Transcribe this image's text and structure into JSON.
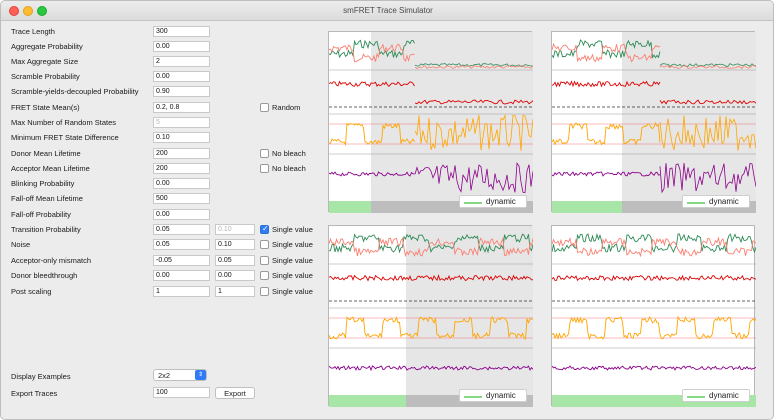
{
  "window": {
    "title": "smFRET Trace Simulator"
  },
  "params": [
    {
      "label": "Trace Length",
      "v1": "300"
    },
    {
      "label": "Aggregate Probability",
      "v1": "0.00"
    },
    {
      "label": "Max Aggregate Size",
      "v1": "2"
    },
    {
      "label": "Scramble Probability",
      "v1": "0.00"
    },
    {
      "label": "Scramble-yields-decoupled Probability",
      "v1": "0.90"
    },
    {
      "label": "FRET State Mean(s)",
      "v1": "0.2, 0.8",
      "check": {
        "label": "Random",
        "checked": false
      }
    },
    {
      "label": "Max Number of Random States",
      "v1": "5",
      "v1_disabled": true
    },
    {
      "label": "Minimum FRET State Difference",
      "v1": "0.10"
    },
    {
      "label": "Donor Mean Lifetime",
      "v1": "200",
      "check": {
        "label": "No bleach",
        "checked": false
      }
    },
    {
      "label": "Acceptor Mean Lifetime",
      "v1": "200",
      "check": {
        "label": "No bleach",
        "checked": false
      }
    },
    {
      "label": "Blinking Probability",
      "v1": "0.00"
    },
    {
      "label": "Fall-off Mean Lifetime",
      "v1": "500"
    },
    {
      "label": "Fall-off Probability",
      "v1": "0.00"
    },
    {
      "label": "Transition Probability",
      "v1": "0.05",
      "v2": "0.10",
      "v2_disabled": true,
      "check": {
        "label": "Single value",
        "checked": true
      }
    },
    {
      "label": "Noise",
      "v1": "0.05",
      "v2": "0.10",
      "check": {
        "label": "Single value",
        "checked": false
      }
    },
    {
      "label": "Acceptor-only mismatch",
      "v1": "-0.05",
      "v2": "0.05",
      "check": {
        "label": "Single value",
        "checked": false
      }
    },
    {
      "label": "Donor bleedthrough",
      "v1": "0.00",
      "v2": "0.00",
      "check": {
        "label": "Single value",
        "checked": false
      }
    },
    {
      "label": "Post scaling",
      "v1": "1",
      "v2": "1",
      "check": {
        "label": "Single value",
        "checked": false
      }
    }
  ],
  "display_examples": {
    "label": "Display Examples",
    "value": "2x2"
  },
  "export": {
    "label": "Export Traces",
    "value": "100",
    "button": "Export"
  },
  "plots": [
    {
      "legend": "dynamic"
    },
    {
      "legend": "dynamic"
    },
    {
      "legend": "dynamic"
    },
    {
      "legend": "dynamic"
    }
  ],
  "colors": {
    "donor": "#2e8b57",
    "acceptor": "#fa8072",
    "total": "#dd0000",
    "fret": "#ffa500",
    "stoich": "#8b008b",
    "dynamic_bar": "#a8e6a8",
    "bleached_bar": "#bdbdbd"
  }
}
